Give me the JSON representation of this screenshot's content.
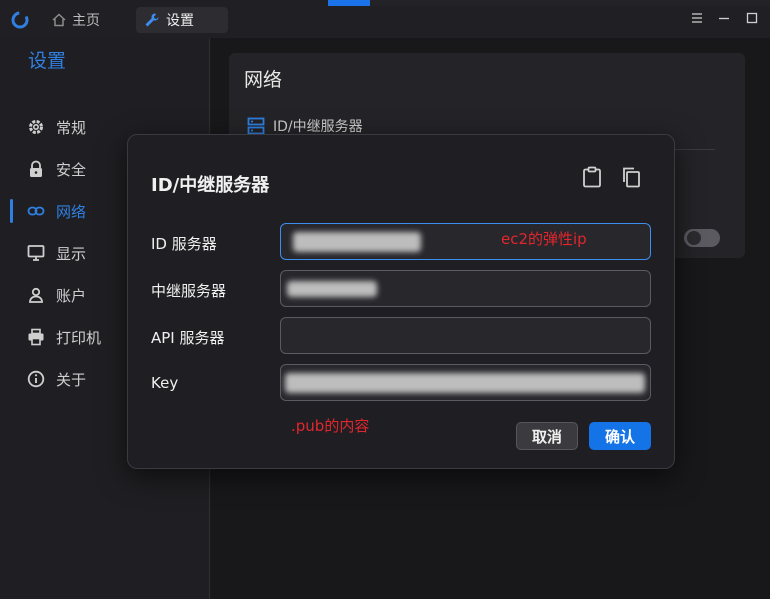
{
  "titlebar": {
    "tabs": [
      {
        "label": "主页",
        "icon": "home-icon"
      },
      {
        "label": "设置",
        "icon": "wrench-icon"
      }
    ]
  },
  "sidebar": {
    "title": "设置",
    "items": [
      {
        "label": "常规",
        "icon": "gear-icon"
      },
      {
        "label": "安全",
        "icon": "lock-icon"
      },
      {
        "label": "网络",
        "icon": "link-icon",
        "active": true
      },
      {
        "label": "显示",
        "icon": "monitor-icon"
      },
      {
        "label": "账户",
        "icon": "person-icon"
      },
      {
        "label": "打印机",
        "icon": "printer-icon"
      },
      {
        "label": "关于",
        "icon": "info-icon"
      }
    ]
  },
  "main": {
    "card_title": "网络",
    "row_label": "ID/中继服务器"
  },
  "dialog": {
    "title": "ID/中继服务器",
    "fields": [
      {
        "label": "ID 服务器",
        "value": ""
      },
      {
        "label": "中继服务器",
        "value": ""
      },
      {
        "label": "API 服务器",
        "value": ""
      },
      {
        "label": "Key",
        "value": ""
      }
    ],
    "cancel_label": "取消",
    "ok_label": "确认"
  },
  "annotations": {
    "id_note": "ec2的弹性ip",
    "key_note": ".pub的内容"
  },
  "colors": {
    "accent": "#2f7fe0",
    "annotation": "#e2262d",
    "ok_button": "#1473e6"
  }
}
